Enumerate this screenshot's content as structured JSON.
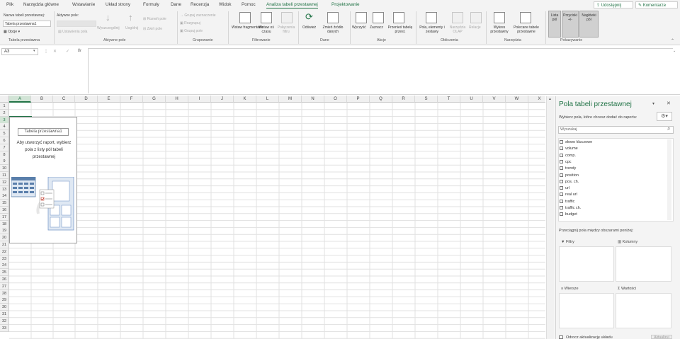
{
  "menu": {
    "tabs": [
      "Plik",
      "Narzędzia główne",
      "Wstawianie",
      "Układ strony",
      "Formuły",
      "Dane",
      "Recenzja",
      "Widok",
      "Pomoc",
      "Analiza tabeli przestawnej",
      "Projektowanie"
    ],
    "share": "Udostępnij",
    "comments": "Komentarze"
  },
  "ribbon": {
    "pivot_name_label": "Nazwa tabeli przestawnej:",
    "pivot_name_value": "Tabela przestawna1",
    "options": "Opcje",
    "group_pivot": "Tabela przestawna",
    "active_field_label": "Aktywne pole:",
    "field_settings": "Ustawienia pola",
    "drill_down": "Wyszczególnij",
    "drill_up": "Uogólnij",
    "expand_field": "Rozwiń pole",
    "collapse_field": "Zwiń pole",
    "group_active_field": "Aktywne pole",
    "group_selection": "Grupuj zaznaczenie",
    "ungroup": "Rozgrupuj",
    "group_field": "Grupuj pole",
    "group_grouping": "Grupowanie",
    "insert_slicer": "Wstaw fragmentator",
    "insert_timeline": "Wstaw oś czasu",
    "filter_connections": "Połączenia filtru",
    "group_filter": "Filtrowanie",
    "refresh": "Odśwież",
    "change_source": "Zmień źródło danych",
    "group_data": "Dane",
    "clear": "Wyczyść",
    "select": "Zaznacz",
    "move_pivot": "Przenieś tabelę przest.",
    "group_actions": "Akcje",
    "fields_items": "Pola, elementy i zestawy",
    "olap_tools": "Narzędzia OLAP",
    "relations": "Relacje",
    "group_calc": "Obliczenia",
    "pivot_chart": "Wykres przestawny",
    "recommended": "Polecane tabele przestawne",
    "group_tools": "Narzędzia",
    "field_list": "Lista pól",
    "buttons": "Przyciski +/-",
    "headers": "Nagłówki pól",
    "group_show": "Pokazywanie"
  },
  "formula": {
    "namebox": "A3",
    "fx": "fx"
  },
  "grid": {
    "columns": [
      "A",
      "B",
      "C",
      "D",
      "E",
      "F",
      "G",
      "H",
      "I",
      "J",
      "K",
      "L",
      "M",
      "N",
      "O",
      "P",
      "Q",
      "R",
      "S",
      "T",
      "U",
      "V",
      "W",
      "X"
    ],
    "rows": [
      "1",
      "2",
      "3",
      "4",
      "5",
      "6",
      "7",
      "8",
      "9",
      "10",
      "11",
      "12",
      "13",
      "14",
      "15",
      "16",
      "17",
      "18",
      "19",
      "20",
      "21",
      "22",
      "23",
      "24",
      "25",
      "26",
      "27",
      "28",
      "29",
      "30",
      "31",
      "32",
      "33"
    ],
    "selected_col": "A",
    "selected_row": "3"
  },
  "placeholder": {
    "title": "Tabela przestawna1",
    "text_line1": "Aby utworzyć raport, wybierz",
    "text_line2": "pola z listy pól tabeli",
    "text_line3": "przestawnej"
  },
  "panel": {
    "title": "Pola tabeli przestawnej",
    "subtitle": "Wybierz pola, które chcesz dodać do raportu:",
    "search_placeholder": "Wyszukaj",
    "fields": [
      "słowo kluczowe",
      "volume",
      "comp.",
      "cpc",
      "trendy",
      "position",
      "pos. ch.",
      "url",
      "real url",
      "traffic",
      "traffic ch.",
      "budget"
    ],
    "drag_hint": "Przeciągnij pola między obszarami poniżej:",
    "area_filters": "Filtry",
    "area_columns": "Kolumny",
    "area_rows": "Wiersze",
    "area_values": "Wartości",
    "defer_update": "Odrocz aktualizację układu",
    "update_button": "Aktualizuj"
  }
}
